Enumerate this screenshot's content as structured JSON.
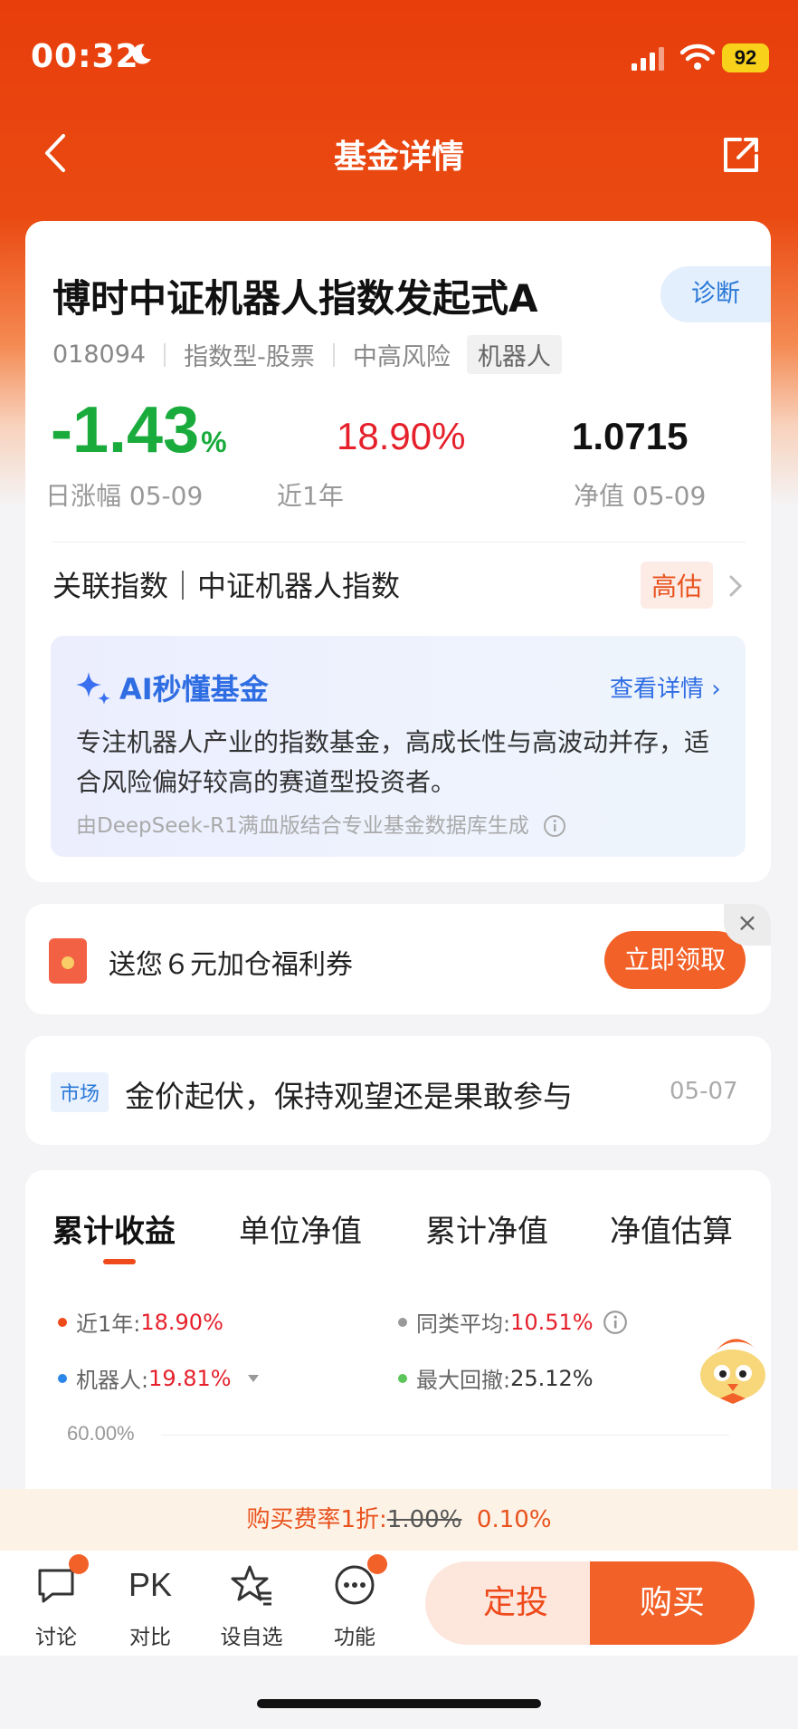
{
  "status_bar": {
    "time": "00:32",
    "battery": "92"
  },
  "nav": {
    "title": "基金详情"
  },
  "fund": {
    "name": "博时中证机器人指数发起式A",
    "diagnose_label": "诊断",
    "code": "018094",
    "type": "指数型-股票",
    "risk": "中高风险",
    "tag": "机器人",
    "daily_change": "-1.43",
    "daily_change_unit": "%",
    "daily_change_label": "日涨幅 05-09",
    "year_return": "18.90%",
    "year_return_label": "近1年",
    "nav_value": "1.0715",
    "nav_label": "净值 05-09"
  },
  "index": {
    "label": "关联指数｜中证机器人指数",
    "valuation": "高估"
  },
  "ai": {
    "title": "AI秒懂基金",
    "link": "查看详情",
    "body": "专注机器人产业的指数基金，高成长性与高波动并存，适合风险偏好较高的赛道型投资者。",
    "note": "由DeepSeek-R1满血版结合专业基金数据库生成"
  },
  "coupon": {
    "text": "送您６元加仓福利券",
    "button": "立即领取",
    "close": "×"
  },
  "news": {
    "tag": "市场",
    "title": "金价起伏，保持观望还是果敢参与",
    "date": "05-07"
  },
  "chart": {
    "tabs": [
      "累计收益",
      "单位净值",
      "累计净值",
      "净值估算"
    ],
    "legend": {
      "year_label": "近1年:",
      "year_value": "18.90%",
      "peer_label": "同类平均:",
      "peer_value": "10.51%",
      "index_label": "机器人:",
      "index_value": "19.81%",
      "drawdown_label": "最大回撤:",
      "drawdown_value": "25.12%"
    },
    "y_top": "60.00%"
  },
  "fee": {
    "label": "购买费率1折:",
    "original": "1.00%",
    "discounted": "0.10%"
  },
  "bottom": {
    "discuss": "讨论",
    "pk_icon": "PK",
    "compare": "对比",
    "watchlist": "设自选",
    "functions": "功能",
    "auto_invest": "定投",
    "buy": "购买"
  },
  "colors": {
    "brand": "#e83e0c",
    "down": "#1aab3d",
    "up": "#e5202b",
    "ai": "#2f6de3"
  }
}
